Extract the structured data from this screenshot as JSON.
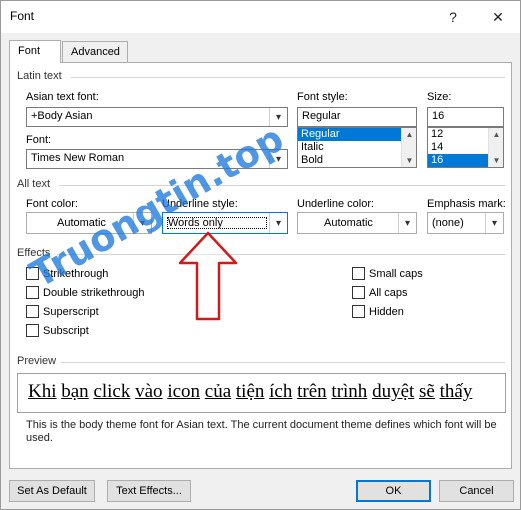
{
  "dialog": {
    "title": "Font",
    "help_glyph": "?",
    "close_glyph": "✕"
  },
  "tabs": [
    {
      "label": "Font",
      "active": true
    },
    {
      "label": "Advanced",
      "active": false
    }
  ],
  "latin": {
    "section": "Latin text",
    "asian_label": "Asian text font:",
    "asian_value": "+Body Asian",
    "font_label": "Font:",
    "font_value": "Times New Roman",
    "style_label": "Font style:",
    "style_value": "Regular",
    "style_list": [
      "Regular",
      "Italic",
      "Bold"
    ],
    "size_label": "Size:",
    "size_value": "16",
    "size_list": [
      "12",
      "14",
      "16"
    ]
  },
  "alltext": {
    "section": "All text",
    "color_label": "Font color:",
    "color_value": "Automatic",
    "underline_style_label": "Underline style:",
    "underline_style_value": "Words only",
    "underline_color_label": "Underline color:",
    "underline_color_value": "Automatic",
    "emphasis_label": "Emphasis mark:",
    "emphasis_value": "(none)"
  },
  "effects": {
    "section": "Effects",
    "left": [
      "Strikethrough",
      "Double strikethrough",
      "Superscript",
      "Subscript"
    ],
    "right": [
      "Small caps",
      "All caps",
      "Hidden"
    ]
  },
  "preview": {
    "section": "Preview",
    "words": [
      "Khi",
      "bạn",
      "click",
      "vào",
      "icon",
      "của",
      "tiện",
      "ích",
      "trên",
      "trình",
      "duyệt",
      "sẽ",
      "thấy"
    ],
    "description": "This is the body theme font for Asian text. The current document theme defines which font will be used."
  },
  "buttons": {
    "set_default": "Set As Default",
    "text_effects": "Text Effects...",
    "ok": "OK",
    "cancel": "Cancel"
  },
  "watermark": {
    "text": "Truongtin.top",
    "color": "#1e78dc"
  },
  "icons": {
    "dropdown": "▾",
    "scroll_up": "▲",
    "scroll_down": "▼"
  },
  "colors": {
    "selection": "#0078d7",
    "arrow_red": "#d21a1a"
  }
}
